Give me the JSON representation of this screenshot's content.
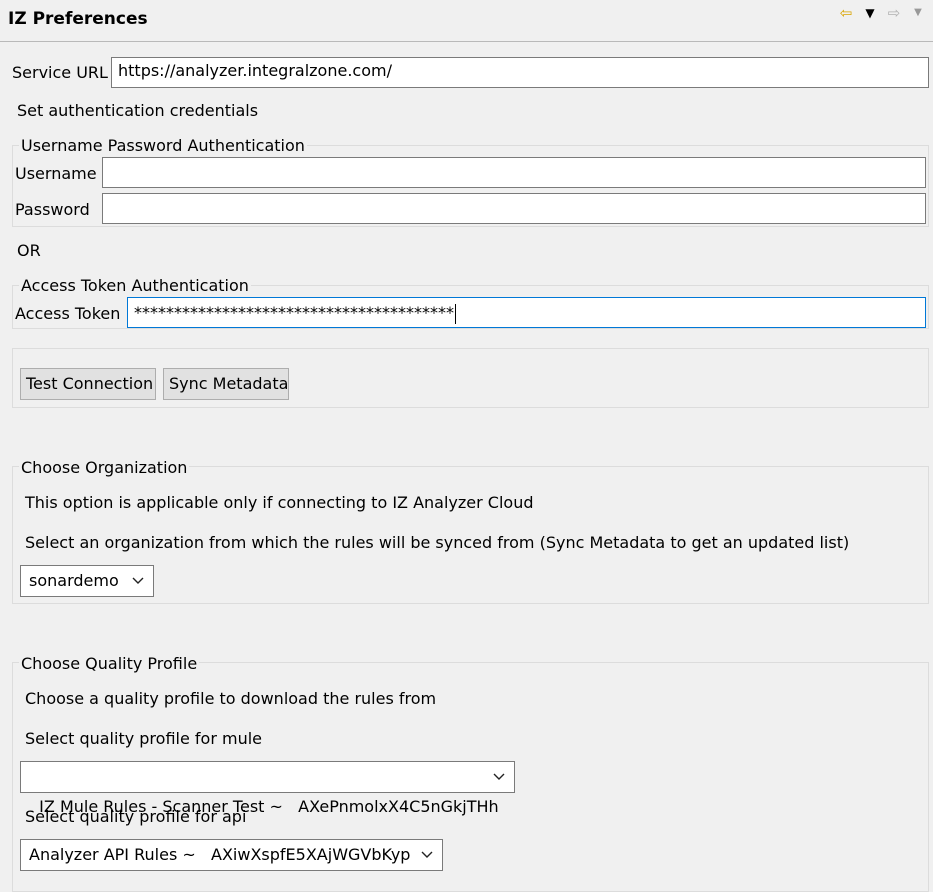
{
  "header": {
    "title": "IZ Preferences"
  },
  "service": {
    "label": "Service URL",
    "value": "https://analyzer.integralzone.com/"
  },
  "auth_intro": "Set authentication credentials",
  "userpass": {
    "legend": "Username Password Authentication",
    "username_label": "Username",
    "username_value": "",
    "password_label": "Password",
    "password_value": ""
  },
  "or_label": "OR",
  "token": {
    "legend": "Access Token Authentication",
    "label": "Access Token",
    "value": "****************************************"
  },
  "actions": {
    "test_connection": "Test Connection",
    "sync_metadata": "Sync Metadata"
  },
  "organization": {
    "legend": "Choose Organization",
    "note": "This option is applicable only if connecting to IZ Analyzer Cloud",
    "instruction": "Select an organization from which the rules will be synced from (Sync Metadata to get an updated list)",
    "selected": "sonardemo"
  },
  "quality_profile": {
    "legend": "Choose Quality Profile",
    "instruction": "Choose a quality profile to download the rules from",
    "mule_label": "Select quality profile for mule",
    "mule_selected": "IZ Mule Rules - Scanner Test ~   AXePnmolxX4C5nGkjTHh",
    "api_label": "Select quality profile for api",
    "api_selected": "Analyzer API Rules ~   AXiwXspfE5XAjWGVbKyp"
  }
}
